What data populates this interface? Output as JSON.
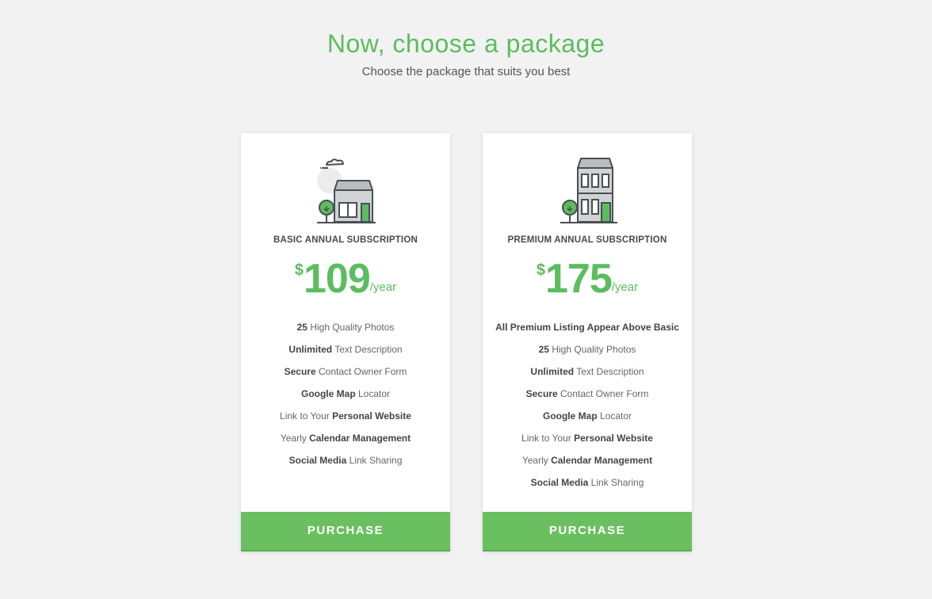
{
  "header": {
    "title": "Now, choose a package",
    "subtitle": "Choose the package that suits you best"
  },
  "colors": {
    "accent": "#5cbd5e",
    "button": "#6abf60",
    "background": "#f2f2f2"
  },
  "packages": [
    {
      "name": "BASIC ANNUAL SUBSCRIPTION",
      "icon": "small-house-icon",
      "currency": "$",
      "price": "109",
      "period": "/year",
      "features": [
        {
          "bold1": "25",
          "normal": " High Quality Photos",
          "bold2": ""
        },
        {
          "bold1": "Unlimited",
          "normal": " Text Description",
          "bold2": ""
        },
        {
          "bold1": "Secure",
          "normal": " Contact Owner Form",
          "bold2": ""
        },
        {
          "bold1": "Google Map",
          "normal": " Locator",
          "bold2": ""
        },
        {
          "bold1": "",
          "normal": "Link to Your ",
          "bold2": "Personal Website"
        },
        {
          "bold1": "",
          "normal": "Yearly ",
          "bold2": "Calendar Management"
        },
        {
          "bold1": "Social Media",
          "normal": " Link Sharing",
          "bold2": ""
        }
      ],
      "button_label": "PURCHASE"
    },
    {
      "name": "PREMIUM ANNUAL SUBSCRIPTION",
      "icon": "two-story-building-icon",
      "currency": "$",
      "price": "175",
      "period": "/year",
      "features": [
        {
          "bold1": "All Premium Listing Appear Above Basic",
          "normal": "",
          "bold2": ""
        },
        {
          "bold1": "25",
          "normal": " High Quality Photos",
          "bold2": ""
        },
        {
          "bold1": "Unlimited",
          "normal": " Text Description",
          "bold2": ""
        },
        {
          "bold1": "Secure",
          "normal": " Contact Owner Form",
          "bold2": ""
        },
        {
          "bold1": "Google Map",
          "normal": " Locator",
          "bold2": ""
        },
        {
          "bold1": "",
          "normal": "Link to Your ",
          "bold2": "Personal Website"
        },
        {
          "bold1": "",
          "normal": "Yearly ",
          "bold2": "Calendar Management"
        },
        {
          "bold1": "Social Media",
          "normal": " Link Sharing",
          "bold2": ""
        }
      ],
      "button_label": "PURCHASE"
    }
  ]
}
